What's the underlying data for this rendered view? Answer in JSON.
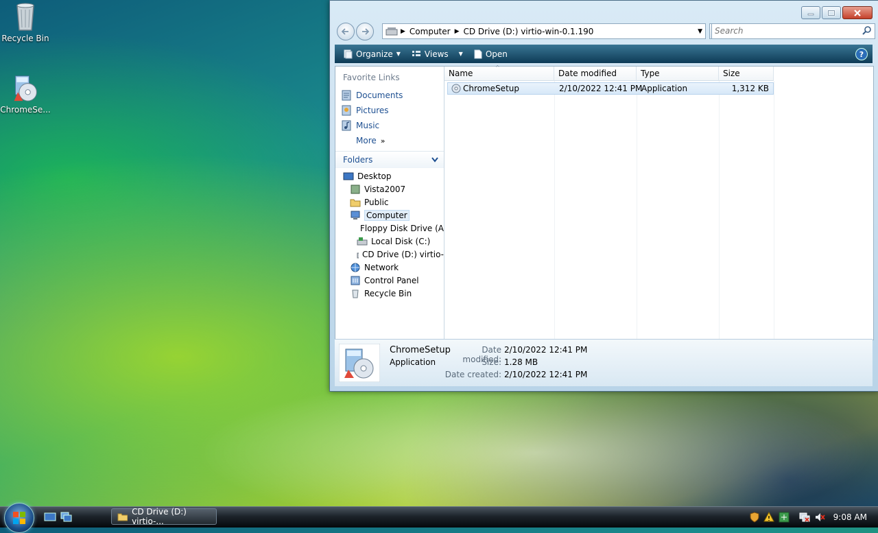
{
  "desktop": {
    "icons": [
      {
        "label": "Recycle Bin"
      },
      {
        "label": "ChromeSe..."
      }
    ]
  },
  "window": {
    "address": {
      "root": "Computer",
      "current": "CD Drive (D:) virtio-win-0.1.190"
    },
    "search_placeholder": "Search",
    "toolbar": {
      "organize": "Organize",
      "views": "Views",
      "open": "Open",
      "help": "?"
    },
    "favorite_links": {
      "title": "Favorite Links",
      "items": [
        "Documents",
        "Pictures",
        "Music",
        "More"
      ]
    },
    "folders": {
      "title": "Folders",
      "tree": [
        {
          "label": "Desktop",
          "level": 0
        },
        {
          "label": "Vista2007",
          "level": 1
        },
        {
          "label": "Public",
          "level": 1
        },
        {
          "label": "Computer",
          "level": 1,
          "selected": true
        },
        {
          "label": "Floppy Disk Drive (A",
          "level": 2
        },
        {
          "label": "Local Disk (C:)",
          "level": 2
        },
        {
          "label": "CD Drive (D:) virtio-",
          "level": 2
        },
        {
          "label": "Network",
          "level": 1
        },
        {
          "label": "Control Panel",
          "level": 1
        },
        {
          "label": "Recycle Bin",
          "level": 1
        }
      ]
    },
    "columns": [
      "Name",
      "Date modified",
      "Type",
      "Size"
    ],
    "files": [
      {
        "name": "ChromeSetup",
        "date": "2/10/2022 12:41 PM",
        "type": "Application",
        "size": "1,312 KB"
      }
    ],
    "details": {
      "name": "ChromeSetup",
      "type": "Application",
      "date_modified_label": "Date modified:",
      "date_modified": "2/10/2022 12:41 PM",
      "size_label": "Size:",
      "size": "1.28 MB",
      "date_created_label": "Date created:",
      "date_created": "2/10/2022 12:41 PM"
    }
  },
  "taskbar": {
    "task_label": "CD Drive (D:) virtio-...",
    "clock": "9:08 AM"
  },
  "colors": {
    "toolbar": "#0e3b56",
    "link": "#1d4f91",
    "selection": "#d7e8f8"
  }
}
